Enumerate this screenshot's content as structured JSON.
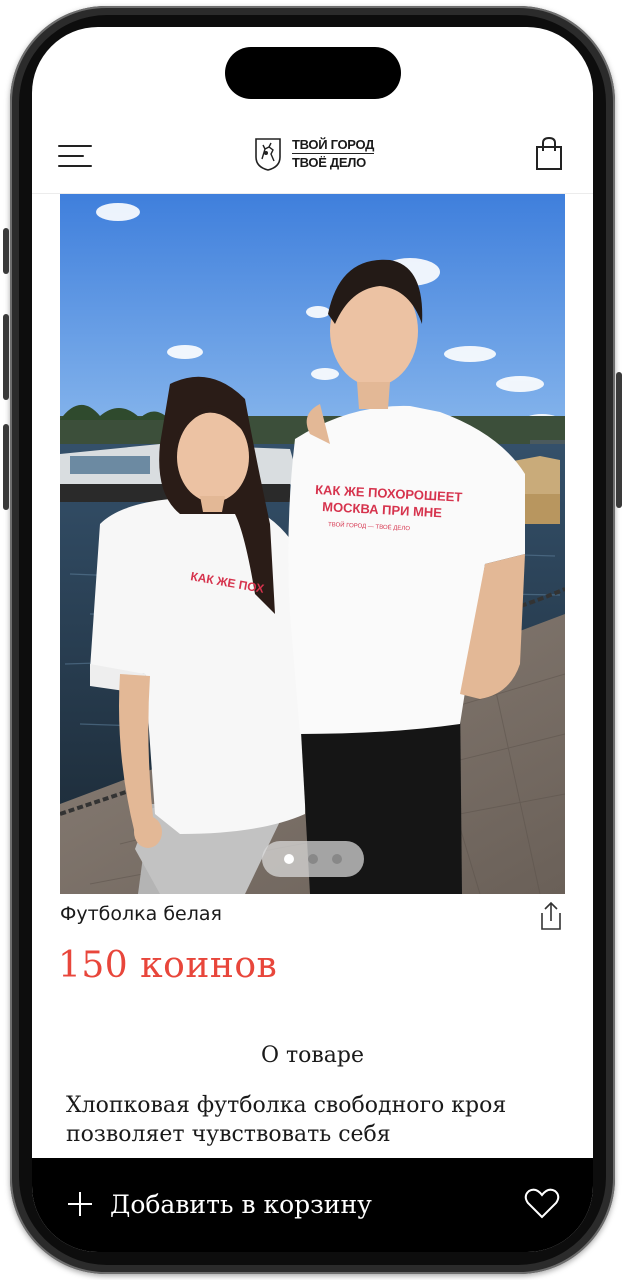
{
  "header": {
    "logo_line1": "ТВОЙ ГОРОД",
    "logo_line2": "ТВОЁ ДЕЛО"
  },
  "product_image": {
    "shirt_print_line1": "КАК ЖЕ ПОХОРОШЕЕТ",
    "shirt_print_line2": "МОСКВА ПРИ МНЕ",
    "shirt_print_line3": "ТВОЙ ГОРОД — ТВОЁ ДЕЛО",
    "carousel": {
      "total": 3,
      "active": 1
    }
  },
  "product": {
    "name": "Футболка белая",
    "price": "150 коинов"
  },
  "about": {
    "title": "О товаре",
    "description": "Хлопковая футболка свободного кроя позволяет чувствовать себя"
  },
  "actions": {
    "add_to_cart_label": "Добавить в корзину"
  },
  "icons": {
    "menu": "hamburger-menu-icon",
    "cart": "shopping-bag-icon",
    "share": "share-icon",
    "add": "plus-icon",
    "favorite": "heart-icon"
  },
  "colors": {
    "price": "#e8463b",
    "bottom_bar": "#000000",
    "print": "#d6334d"
  }
}
